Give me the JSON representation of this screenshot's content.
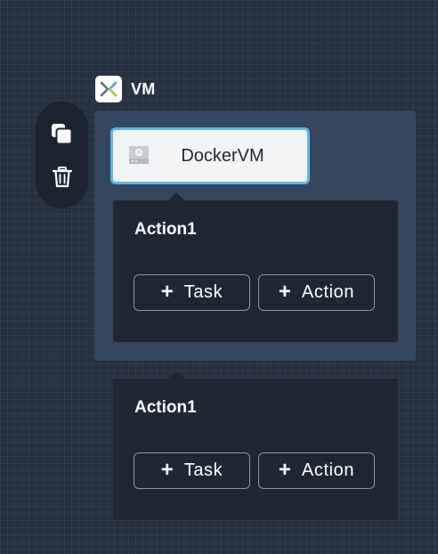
{
  "toolbar": {
    "copy_icon": "copy-icon",
    "delete_icon": "trash-icon"
  },
  "vm": {
    "title": "VM",
    "logo_icon": "nutanix-x-logo"
  },
  "substrate": {
    "name": "DockerVM",
    "icon": "server-icon"
  },
  "actions": [
    {
      "title": "Action1",
      "task_plus": "+",
      "task_label": "Task",
      "action_plus": "+",
      "action_label": "Action"
    },
    {
      "title": "Action1",
      "task_plus": "+",
      "task_label": "Task",
      "action_plus": "+",
      "action_label": "Action"
    }
  ],
  "colors": {
    "canvas": "#263241",
    "vm_container": "#34475e",
    "panel": "#1f2735",
    "selection": "#5eb5ec",
    "card": "#f2f3f5"
  }
}
